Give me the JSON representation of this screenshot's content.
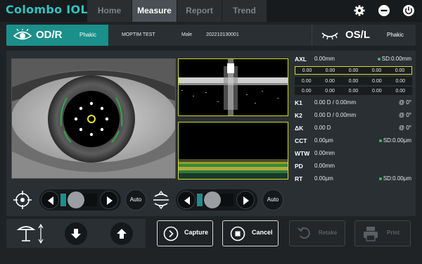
{
  "app": {
    "logo": "Colombo IOL"
  },
  "tabs": [
    {
      "label": "Home",
      "active": false
    },
    {
      "label": "Measure",
      "active": true
    },
    {
      "label": "Report",
      "active": false
    },
    {
      "label": "Trend",
      "active": false
    }
  ],
  "header_icons": [
    "gear-icon",
    "minimize-icon",
    "power-icon"
  ],
  "right_eye": {
    "label": "OD/R",
    "lens": "Phakic",
    "active": true
  },
  "left_eye": {
    "label": "OS/L",
    "lens": "Phakic",
    "active": false
  },
  "patient": {
    "name": "MOPTIM TEST",
    "sex": "Male",
    "id": "202210130001"
  },
  "measurements": {
    "axl": {
      "label": "AXL",
      "value": "0.00mm",
      "sd": "SD:0.00mm"
    },
    "axl_grid": [
      [
        "0.00",
        "0.00",
        "0.00",
        "0.00",
        "0.00"
      ],
      [
        "0.00",
        "0.00",
        "0.00",
        "0.00",
        "0.00"
      ],
      [
        "0.00",
        "0.00",
        "0.00",
        "0.00",
        "0.00"
      ]
    ],
    "k1": {
      "label": "K1",
      "value": "0.00 D / 0.00mm",
      "axis": "@ 0°"
    },
    "k2": {
      "label": "K2",
      "value": "0.00 D / 0.00mm",
      "axis": "@ 0°"
    },
    "dk": {
      "label": "ΔK",
      "value": "0.00 D",
      "axis": "@ 0°"
    },
    "cct": {
      "label": "CCT",
      "value": "0.00μm",
      "sd": "SD:0.00μm"
    },
    "wtw": {
      "label": "WTW",
      "value": "0.00mm"
    },
    "pd": {
      "label": "PD",
      "value": "0.00mm"
    },
    "rt": {
      "label": "RT",
      "value": "0.00μm",
      "sd": "SD:0.00μm"
    }
  },
  "controls": {
    "auto_left": "Auto",
    "auto_right": "Auto"
  },
  "buttons": {
    "capture": "Capture",
    "cancel": "Cancel",
    "retake": "Retake",
    "print": "Print"
  },
  "colors": {
    "accent": "#1b8f8a",
    "highlight": "#d6d62a",
    "status_dot": "#3bbf5a"
  }
}
